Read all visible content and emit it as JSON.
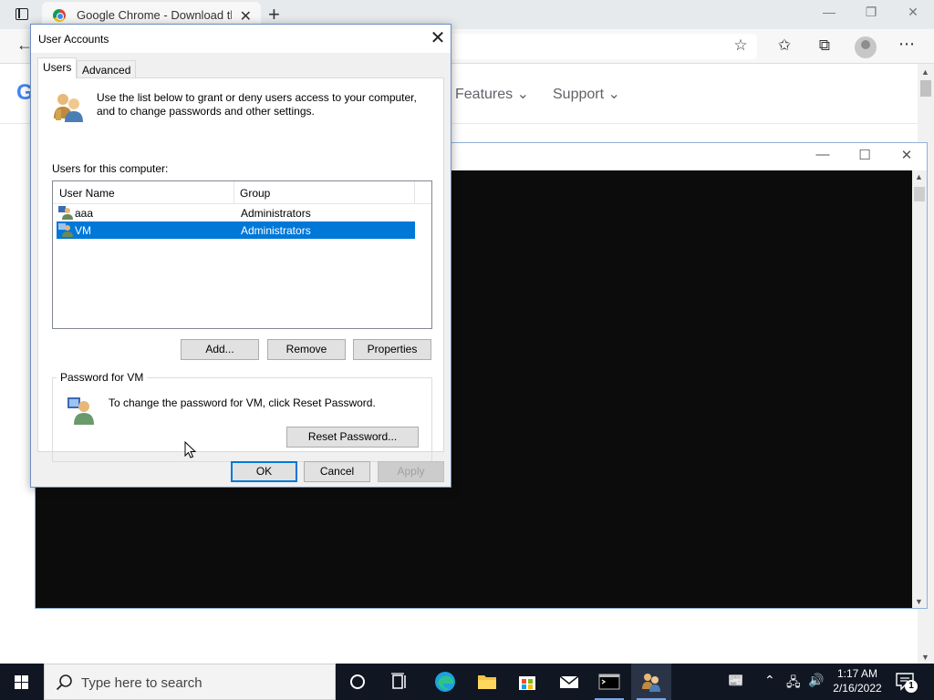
{
  "browser": {
    "tab_title": "Google Chrome - Download the",
    "nav": {
      "features": "Features ⌄",
      "support": "Support ⌄"
    },
    "logo_letter": "G"
  },
  "dialog": {
    "title": "User Accounts",
    "tabs": [
      {
        "label": "Users"
      },
      {
        "label": "Advanced"
      }
    ],
    "intro": "Use the list below to grant or deny users access to your computer, and to change passwords and other settings.",
    "users_label": "Users for this computer:",
    "columns": {
      "name": "User Name",
      "group": "Group"
    },
    "rows": [
      {
        "name": "aaa",
        "group": "Administrators",
        "selected": false
      },
      {
        "name": "VM",
        "group": "Administrators",
        "selected": true
      }
    ],
    "buttons": {
      "add": "Add...",
      "remove": "Remove",
      "properties": "Properties"
    },
    "password": {
      "legend": "Password for VM",
      "text": "To change the password for VM, click Reset Password.",
      "reset": "Reset Password..."
    },
    "footer": {
      "ok": "OK",
      "cancel": "Cancel",
      "apply": "Apply"
    }
  },
  "taskbar": {
    "search_placeholder": "Type here to search",
    "time": "1:17 AM",
    "date": "2/16/2022",
    "notifications": "1"
  },
  "colors": {
    "selection": "#0078d7",
    "taskbar": "#101622",
    "console": "#0c0c0c"
  }
}
